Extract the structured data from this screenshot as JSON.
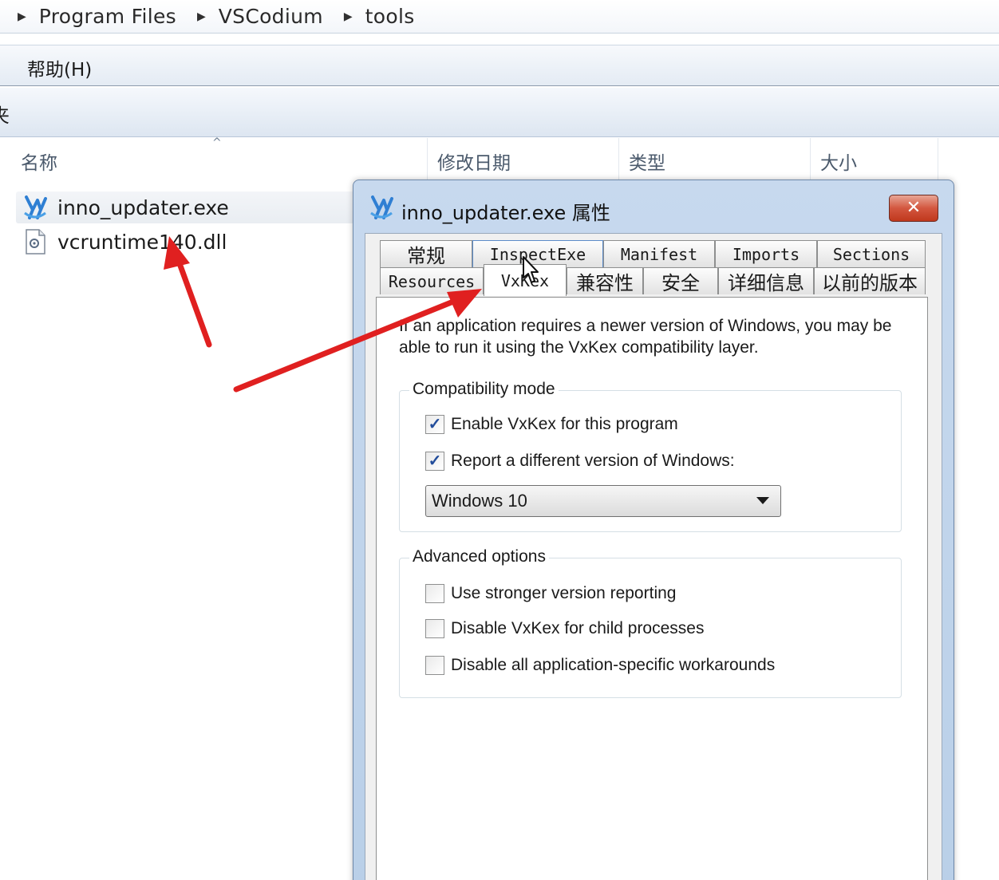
{
  "breadcrumb": {
    "segments": [
      "Program Files",
      "VSCodium",
      "tools"
    ]
  },
  "menubar": {
    "help_label": "帮助(H)"
  },
  "command_bar": {
    "folder_label_partial": "夹"
  },
  "file_list": {
    "columns": [
      "名称",
      "修改日期",
      "类型",
      "大小"
    ],
    "files": [
      {
        "name": "inno_updater.exe",
        "icon": "vscodium-app-icon"
      },
      {
        "name": "vcruntime140.dll",
        "icon": "dll-file-icon"
      }
    ]
  },
  "dialog": {
    "title": "inno_updater.exe 属性",
    "close_label": "✕",
    "tabs_row1": [
      "常规",
      "InspectExe",
      "Manifest",
      "Imports",
      "Sections"
    ],
    "tabs_row2": [
      "Resources",
      "VxKex",
      "兼容性",
      "安全",
      "详细信息",
      "以前的版本"
    ],
    "active_tab": "VxKex",
    "intro_text": "If an application requires a newer version of Windows, you may be able to run it using the VxKex compatibility layer.",
    "compat_group": {
      "title": "Compatibility mode",
      "options": [
        {
          "label": "Enable VxKex for this program",
          "checked": true
        },
        {
          "label": "Report a different version of Windows:",
          "checked": true
        }
      ],
      "windows_version": "Windows 10"
    },
    "advanced_group": {
      "title": "Advanced options",
      "options": [
        {
          "label": "Use stronger version reporting",
          "checked": false
        },
        {
          "label": "Disable VxKex for child processes",
          "checked": false
        },
        {
          "label": "Disable all application-specific workarounds",
          "checked": false
        }
      ]
    }
  },
  "annotations": {
    "arrow_color": "#e02020"
  },
  "colors": {
    "dialog_frame": "#b9cfe8",
    "close_button": "#c9452a",
    "checkmark": "#234d9b"
  }
}
